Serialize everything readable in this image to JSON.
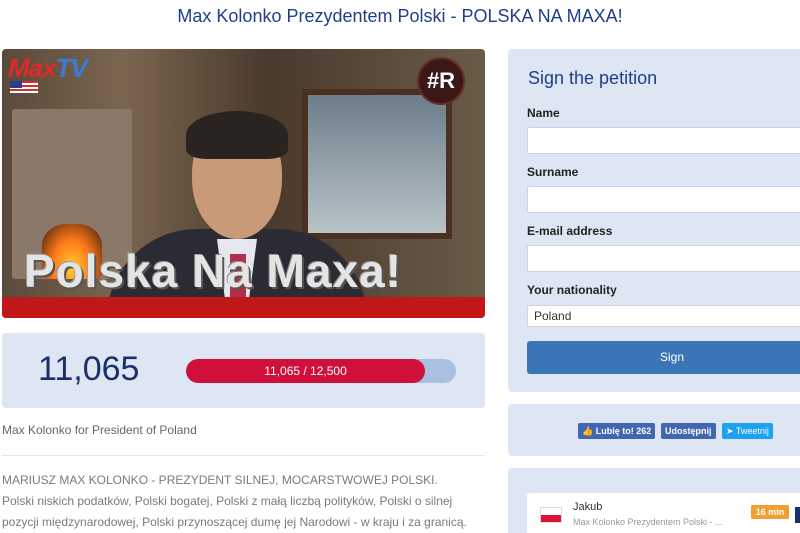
{
  "page": {
    "title": "Max Kolonko Prezydentem Polski - POLSKA NA MAXA!"
  },
  "hero": {
    "logo_max": "Max",
    "logo_tv": "TV",
    "badge": "#R",
    "overlay_text": "Polska Na Maxa!"
  },
  "counter": {
    "count": "11,065",
    "progress_text": "11,065 / 12,500",
    "signed": 11065,
    "goal": 12500
  },
  "petition_subtitle": "Max Kolonko for President of Poland",
  "description": "MARIUSZ MAX KOLONKO - PREZYDENT SILNEJ, MOCARSTWOWEJ POLSKI. Polski niskich podatków, Polski bogatej, Polski z małą liczbą polityków, Polski o silnej pozycji międzynarodowej, Polski przynoszącej dumę jej Narodowi - w kraju i za granicą.",
  "form": {
    "heading": "Sign the petition",
    "name_label": "Name",
    "surname_label": "Surname",
    "email_label": "E-mail address",
    "nationality_label": "Your nationality",
    "nationality_value": "Poland",
    "sign_label": "Sign"
  },
  "social": {
    "like_label": "Lubię to! 262",
    "share_label": "Udostępnij",
    "tweet_label": "Tweetnij"
  },
  "recent": {
    "name": "Jakub",
    "petition_title": "Max Kolonko Prezydentem Polski - ...",
    "time": "16 min"
  },
  "colors": {
    "accent": "#1f3f8a",
    "progress": "#d0103a",
    "sign_button": "#3a76b6",
    "panel": "#dde6f2"
  }
}
